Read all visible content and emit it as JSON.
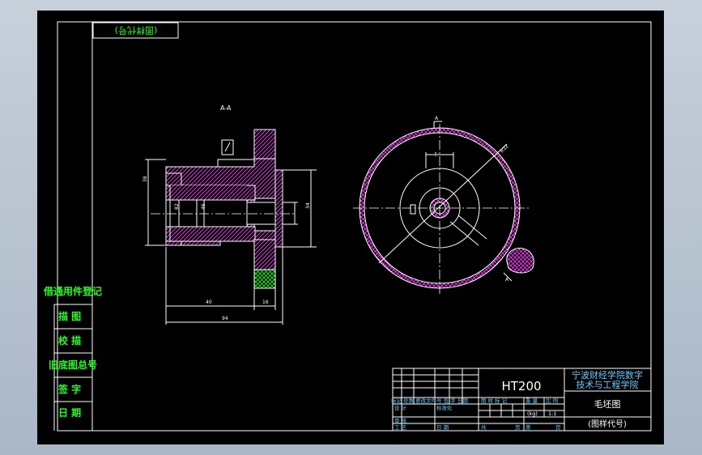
{
  "drawing": {
    "corner_label": "(图样代号)",
    "section_label": "A-A",
    "cut_marker_a_top": "A",
    "cut_marker_a_bottom": "A",
    "radius_label": "R12"
  },
  "side_block": {
    "title": "借通用件登记",
    "rows": [
      "描 图",
      "校 描",
      "旧底图总号",
      "签 字",
      "日 期"
    ]
  },
  "dimensions": {
    "d1": "38",
    "d2": "82",
    "d3": "46",
    "d4": "34",
    "d5": "40",
    "d6": "16",
    "d7": "94"
  },
  "title_block": {
    "material": "HT200",
    "school_line1": "宁波财经学院数字",
    "school_line2": "技术与工程学院",
    "drawing_name": "毛坯图",
    "drawing_code": "(图样代号)",
    "label_design": "设 计",
    "label_standard": "标准化",
    "label_review": "审 核",
    "label_craft": "工 艺",
    "label_date": "日 期",
    "label_mark": "图 样 标 记",
    "label_weight": "重 量",
    "label_scale": "比 例",
    "scale_value": "1:1",
    "weight_unit": "(kg)",
    "label_total": "共",
    "label_sheet": "页",
    "label_no": "第",
    "label_page": "页",
    "revision_row": "标记 处数 更改文件号 签 字 日期"
  }
}
